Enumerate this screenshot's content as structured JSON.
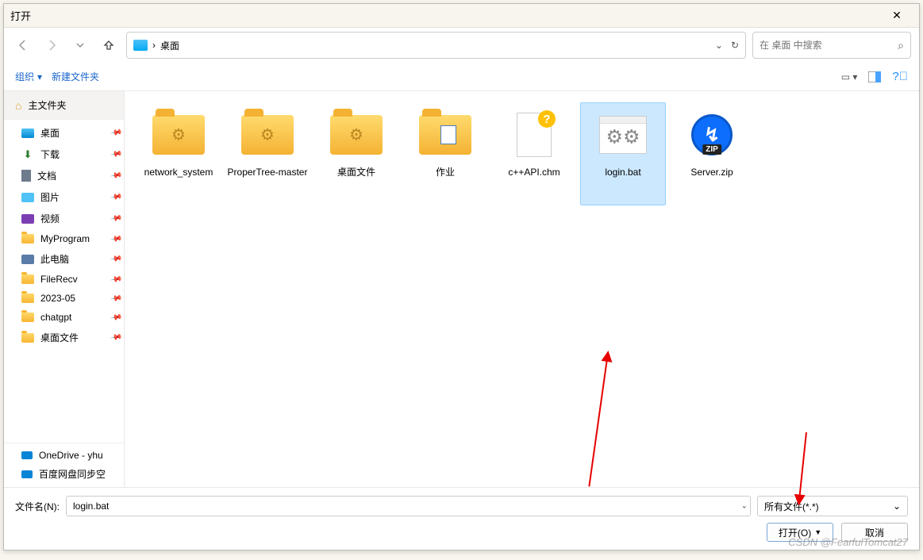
{
  "title": "打开",
  "breadcrumb": {
    "location": "桌面"
  },
  "search": {
    "placeholder": "在 桌面 中搜索"
  },
  "toolbar": {
    "organize": "组织",
    "new_folder": "新建文件夹"
  },
  "sidebar": {
    "home": "主文件夹",
    "items": [
      {
        "label": "桌面",
        "icon": "desktop"
      },
      {
        "label": "下载",
        "icon": "download"
      },
      {
        "label": "文档",
        "icon": "doc"
      },
      {
        "label": "图片",
        "icon": "pic"
      },
      {
        "label": "视频",
        "icon": "video"
      },
      {
        "label": "MyProgram",
        "icon": "folder"
      },
      {
        "label": "此电脑",
        "icon": "pc"
      },
      {
        "label": "FileRecv",
        "icon": "folder"
      },
      {
        "label": "2023-05",
        "icon": "folder"
      },
      {
        "label": "chatgpt",
        "icon": "folder"
      },
      {
        "label": "桌面文件",
        "icon": "folder"
      }
    ],
    "lower": [
      {
        "label": "OneDrive - yhu"
      },
      {
        "label": "百度网盘同步空"
      }
    ]
  },
  "files": [
    {
      "name": "network_system",
      "type": "folder-gear"
    },
    {
      "name": "ProperTree-master",
      "type": "folder-gear"
    },
    {
      "name": "桌面文件",
      "type": "folder-gear"
    },
    {
      "name": "作业",
      "type": "folder-word"
    },
    {
      "name": "c++API.chm",
      "type": "chm"
    },
    {
      "name": "login.bat",
      "type": "bat",
      "selected": true
    },
    {
      "name": "Server.zip",
      "type": "zip"
    }
  ],
  "footer": {
    "filename_label": "文件名(N):",
    "filename_value": "login.bat",
    "filter_label": "所有文件(*.*)",
    "open": "打开(O)",
    "cancel": "取消"
  },
  "watermark": "CSDN @FearfulTomcat27",
  "zip_text": "ZIP"
}
